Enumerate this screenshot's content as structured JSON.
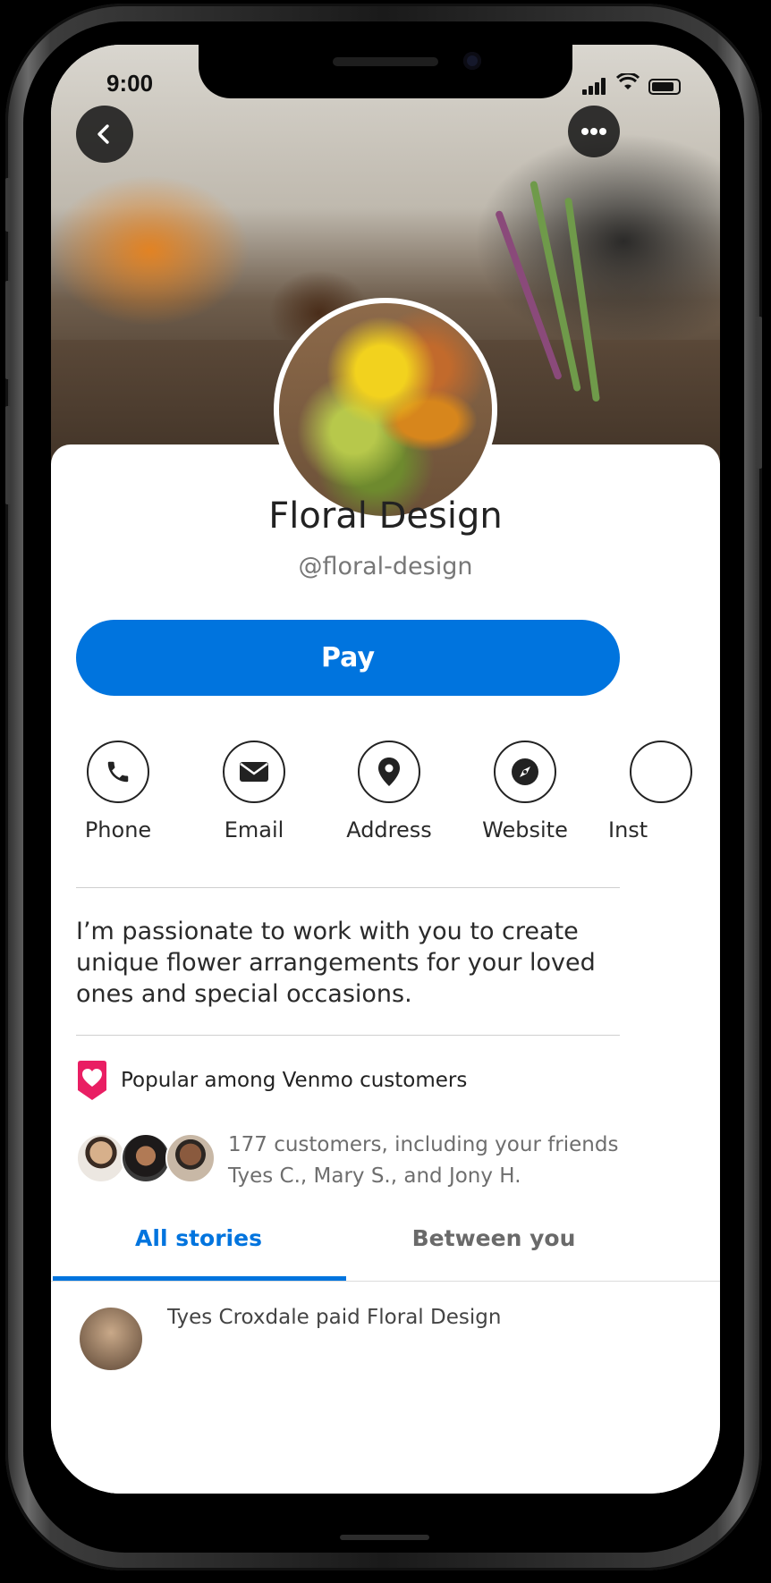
{
  "status_bar": {
    "time": "9:00"
  },
  "profile": {
    "name": "Floral Design",
    "handle": "@floral-design",
    "pay_label": "Pay",
    "bio": "I’m passionate to work with you to create unique flower arrangements for your loved ones and special occasions."
  },
  "actions": [
    {
      "label": "Phone",
      "icon": "phone-icon"
    },
    {
      "label": "Email",
      "icon": "email-icon"
    },
    {
      "label": "Address",
      "icon": "location-pin-icon"
    },
    {
      "label": "Website",
      "icon": "compass-icon"
    },
    {
      "label": "Inst",
      "icon": "instagram-icon"
    }
  ],
  "popular": {
    "label": "Popular among Venmo customers",
    "icon": "heart-badge-icon"
  },
  "customers": {
    "line1": "177 customers, including your friends",
    "line2": "Tyes C., Mary S., and Jony H."
  },
  "tabs": [
    {
      "label": "All stories",
      "active": true
    },
    {
      "label": "Between you",
      "active": false
    }
  ],
  "first_story": {
    "text": "Tyes Croxdale paid Floral Design"
  },
  "colors": {
    "accent": "#0074de",
    "popular_badge": "#e91e63"
  }
}
